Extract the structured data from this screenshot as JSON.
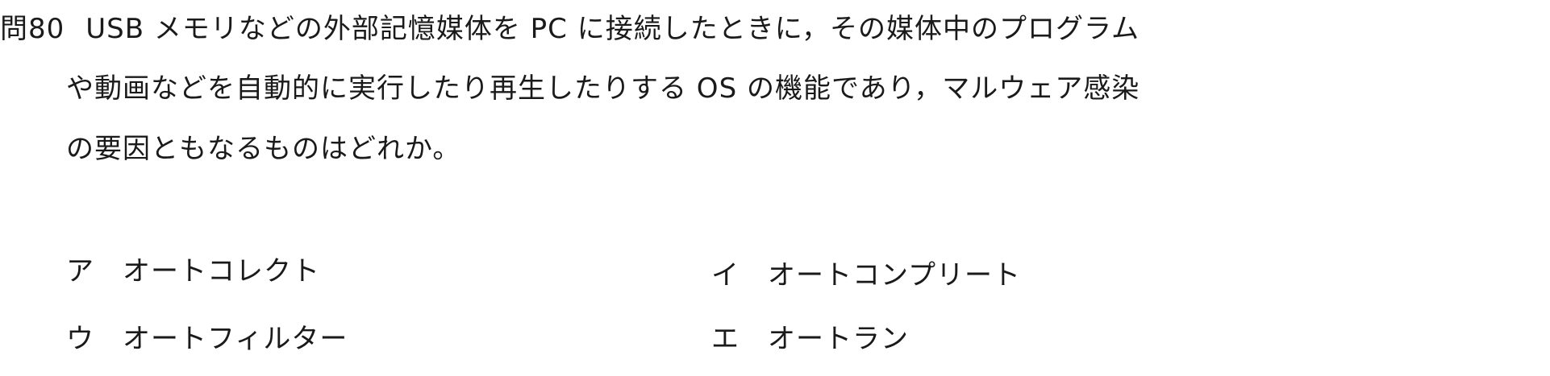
{
  "question": {
    "number": "問80",
    "line1": "USB メモリなどの外部記憶媒体を PC に接続したときに，その媒体中のプログラム",
    "line2": "や動画などを自動的に実行したり再生したりする OS の機能であり，マルウェア感染",
    "line3": "の要因ともなるものはどれか。"
  },
  "choices": [
    {
      "mark": "ア",
      "text": "オートコレクト"
    },
    {
      "mark": "イ",
      "text": "オートコンプリート"
    },
    {
      "mark": "ウ",
      "text": "オートフィルター"
    },
    {
      "mark": "エ",
      "text": "オートラン"
    }
  ]
}
